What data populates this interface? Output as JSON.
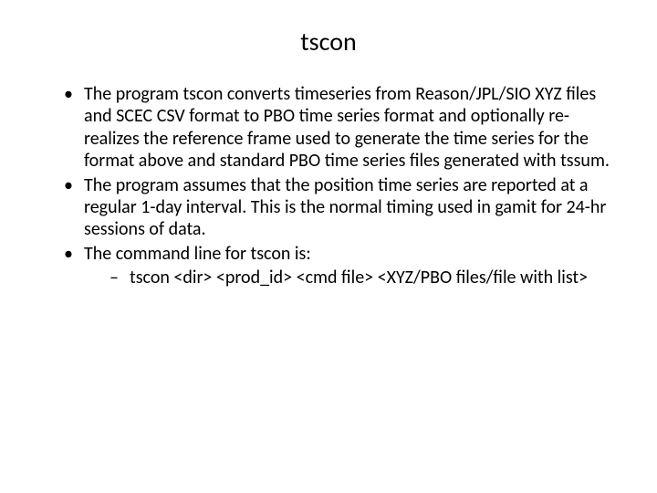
{
  "slide": {
    "title": "tscon",
    "bullets": [
      {
        "text": "The program tscon converts timeseries from Reason/JPL/SIO XYZ files and SCEC CSV format to PBO time series format and optionally re-realizes the reference frame used to generate the time series for the format above and standard PBO time series files generated with tssum."
      },
      {
        "text": "The program assumes that the position time series are reported at a regular 1-day interval.  This is the normal timing used in gamit for 24-hr sessions of data."
      },
      {
        "text": "The command line for tscon is:",
        "sub": [
          "tscon <dir> <prod_id> <cmd file> <XYZ/PBO files/file with list>"
        ]
      }
    ]
  }
}
